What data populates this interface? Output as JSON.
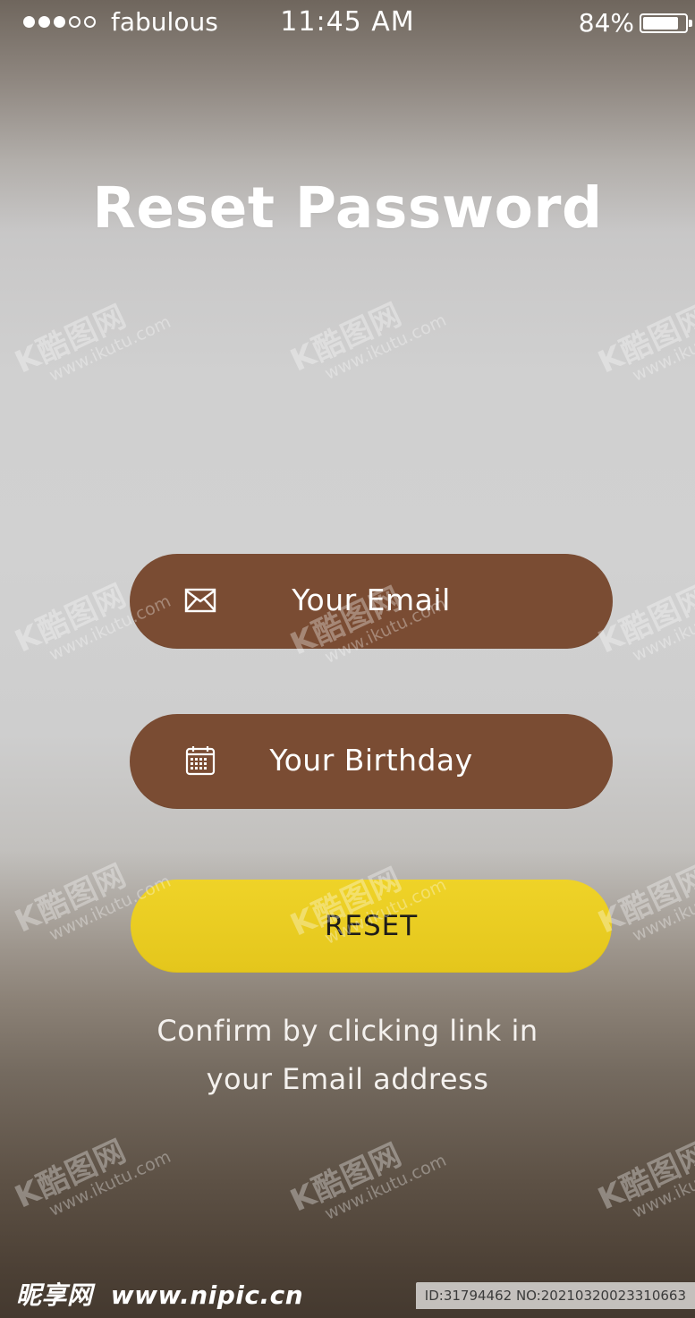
{
  "status_bar": {
    "carrier": "fabulous",
    "time": "11:45 AM",
    "battery_percent": "84%",
    "signal_strength": {
      "filled": 3,
      "total": 5
    },
    "battery_level": 0.84
  },
  "screen": {
    "title": "Reset Password",
    "email_field": {
      "label": "Your Email",
      "icon": "mail-icon"
    },
    "birthday_field": {
      "label": "Your Birthday",
      "icon": "calendar-icon"
    },
    "reset_button": {
      "label": "RESET"
    },
    "confirm_text": {
      "line1": "Confirm by clicking link in",
      "line2": "your Email address"
    }
  },
  "watermarks": {
    "main": "K酷图网",
    "sub": "www.ikutu.com"
  },
  "footer": {
    "brand_left": "昵享网",
    "brand_site": "www.nipic.cn",
    "id_text": "ID:31794462 NO:20210320023310663"
  },
  "colors": {
    "field_brown": "#7a4c33",
    "button_yellow": "#e9cb22",
    "text_white": "#ffffff"
  }
}
